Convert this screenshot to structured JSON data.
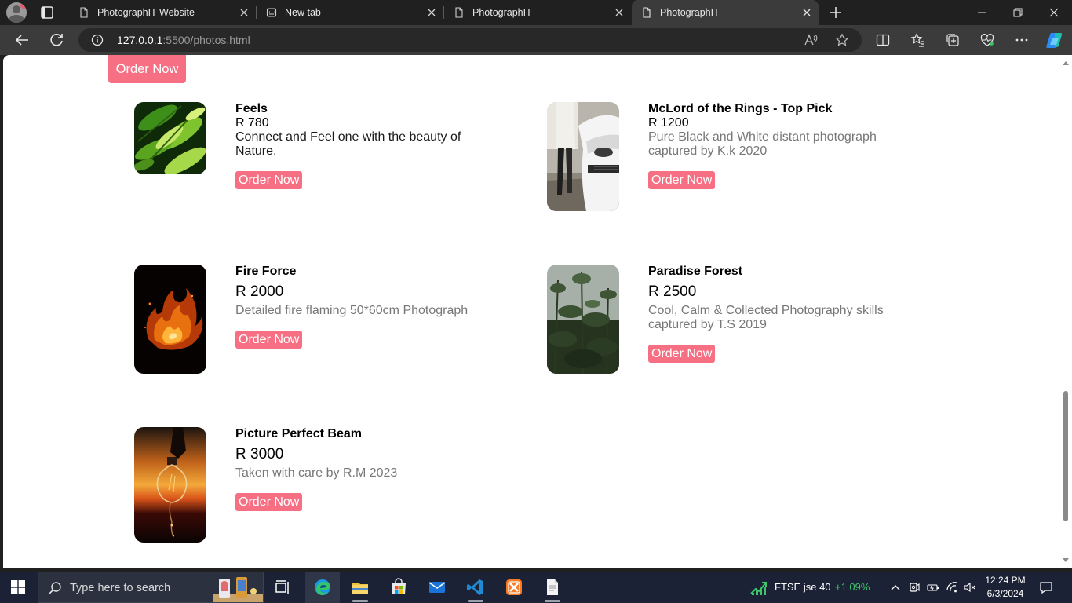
{
  "browser": {
    "tabs": [
      {
        "label": "PhotographIT Website",
        "icon": "page-icon",
        "active": false
      },
      {
        "label": "New tab",
        "icon": "new-tab-page-icon",
        "active": false
      },
      {
        "label": "PhotographIT",
        "icon": "page-icon",
        "active": false
      },
      {
        "label": "PhotographIT",
        "icon": "page-icon",
        "active": true
      }
    ],
    "address": {
      "host": "127.0.0.1",
      "path": ":5500/photos.html"
    }
  },
  "page": {
    "top_order_label": "Order Now",
    "products": [
      {
        "name": "Feels",
        "price": "R 780",
        "description": "Connect and Feel one with the beauty of Nature.",
        "order_label": "Order Now",
        "image": "green-leaves-photo"
      },
      {
        "name": "McLord of the Rings - Top Pick",
        "price": "R 1200",
        "description": "Pure Black and White distant photograph captured by K.k 2020",
        "order_label": "Order Now",
        "image": "car-and-person-photo"
      },
      {
        "name": "Fire Force",
        "price": "R 2000",
        "description": "Detailed fire flaming 50*60cm Photograph",
        "order_label": "Order Now",
        "image": "fire-flames-photo"
      },
      {
        "name": "Paradise Forest",
        "price": "R 2500",
        "description": "Cool, Calm & Collected Photography skills captured by T.S 2019",
        "order_label": "Order Now",
        "image": "forest-plants-photo"
      },
      {
        "name": "Picture Perfect Beam",
        "price": "R 3000",
        "description": "Taken with care by R.M 2023",
        "order_label": "Order Now",
        "image": "light-bulb-sunset-photo"
      }
    ]
  },
  "taskbar": {
    "search_placeholder": "Type here to search",
    "stock": {
      "name": "FTSE jse 40",
      "change": "+1.09%"
    },
    "clock": {
      "time": "12:24 PM",
      "date": "6/3/2024"
    }
  },
  "colors": {
    "accent_button": "#f76f83",
    "browser_chrome": "#3b3b3b",
    "taskbar": "#1b2235",
    "stock_up": "#3fc46a"
  }
}
